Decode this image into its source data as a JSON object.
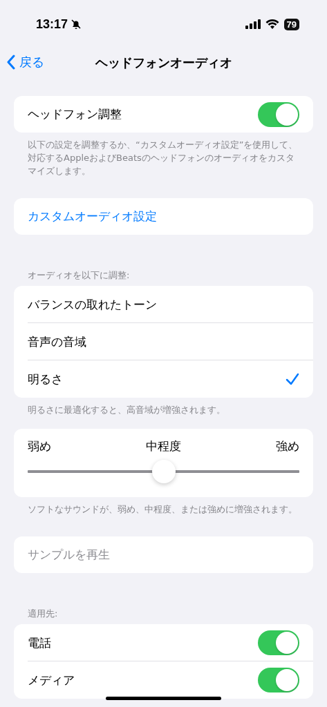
{
  "status_bar": {
    "time": "13:17",
    "battery": "79"
  },
  "nav": {
    "back": "戻る",
    "title": "ヘッドフォンオーディオ"
  },
  "adjust": {
    "label": "ヘッドフォン調整",
    "on": true,
    "footer": "以下の設定を調整するか、“カスタムオーディオ設定”を使用して、対応するAppleおよびBeatsのヘッドフォンのオーディオをカスタマイズします。"
  },
  "custom_link": "カスタムオーディオ設定",
  "tune": {
    "header": "オーディオを以下に調整:",
    "options": [
      {
        "label": "バランスの取れたトーン",
        "selected": false
      },
      {
        "label": "音声の音域",
        "selected": false
      },
      {
        "label": "明るさ",
        "selected": true
      }
    ],
    "footer": "明るさに最適化すると、高音域が増強されます。"
  },
  "strength": {
    "min_label": "弱め",
    "mid_label": "中程度",
    "max_label": "強め",
    "level": 0.5,
    "footer": "ソフトなサウンドが、弱め、中程度、または強めに増強されます。"
  },
  "sample": {
    "label": "サンプルを再生",
    "disabled": true
  },
  "apply": {
    "header": "適用先:",
    "items": [
      {
        "label": "電話",
        "on": true
      },
      {
        "label": "メディア",
        "on": true
      }
    ]
  }
}
